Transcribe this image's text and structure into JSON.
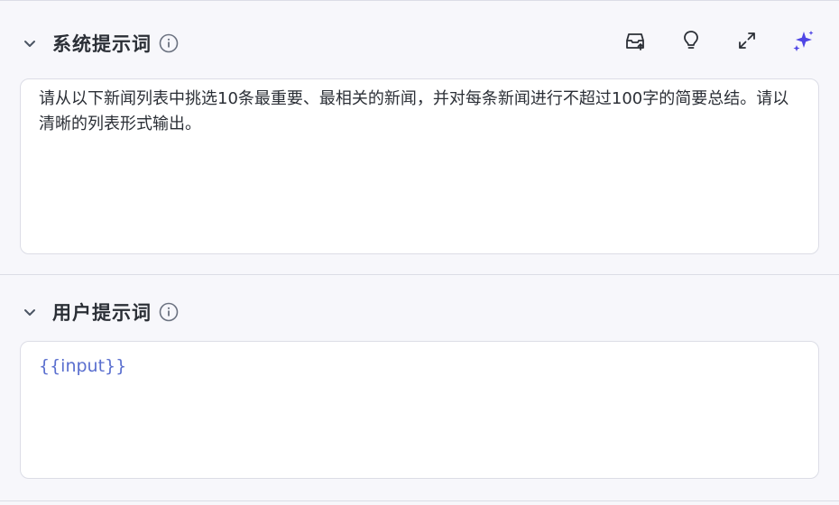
{
  "system": {
    "title": "系统提示词",
    "text": "请从以下新闻列表中挑选10条最重要、最相关的新闻，并对每条新闻进行不超过100字的简要总结。请以清晰的列表形式输出。",
    "toolbar": [
      "save-template-icon",
      "lightbulb-icon",
      "expand-icon",
      "sparkle-icon"
    ],
    "accent": "#4f46e5"
  },
  "user": {
    "title": "用户提示词",
    "text": "{{input}}",
    "variable_color": "#5a6fcf"
  }
}
